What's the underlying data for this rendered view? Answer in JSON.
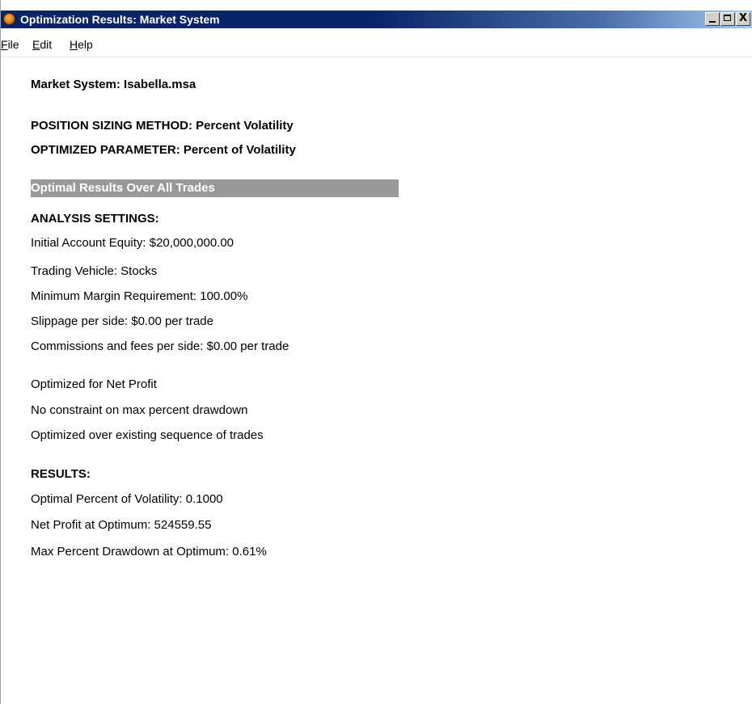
{
  "window": {
    "title": "Optimization Results: Market System",
    "controls": {
      "minimize": "_",
      "maximize": "□",
      "close": "X"
    }
  },
  "menu": {
    "items": [
      {
        "label_first": "F",
        "label_rest": "ile"
      },
      {
        "label_first": "E",
        "label_rest": "dit"
      },
      {
        "label_first": "H",
        "label_rest": "elp"
      }
    ]
  },
  "report": {
    "market_system": "Market System: Isabella.msa",
    "position_sizing_method": "POSITION SIZING METHOD:  Percent Volatility",
    "optimized_parameter": "OPTIMIZED PARAMETER:  Percent of Volatility",
    "section_banner": "Optimal Results Over All Trades",
    "analysis_settings": {
      "heading": "ANALYSIS SETTINGS:",
      "initial_equity": "Initial Account Equity: $20,000,000.00",
      "trading_vehicle": "Trading Vehicle: Stocks",
      "margin": "Minimum Margin Requirement: 100.00%",
      "slippage": "Slippage per side: $0.00 per trade",
      "commissions": "Commissions and fees per side: $0.00 per trade"
    },
    "optimization": {
      "target": "Optimized for Net Profit",
      "constraint": "No constraint on max percent drawdown",
      "sequence": "Optimized over existing sequence of trades"
    },
    "results": {
      "heading": "RESULTS:",
      "optimal_value": "Optimal Percent of Volatility: 0.1000",
      "net_profit": "Net Profit at Optimum: 524559.55",
      "max_drawdown": "Max Percent Drawdown at Optimum: 0.61%"
    }
  }
}
